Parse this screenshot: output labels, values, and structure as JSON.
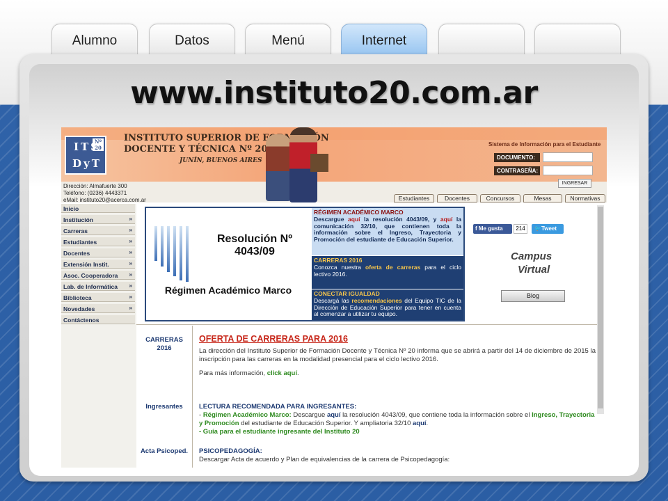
{
  "tabs": [
    {
      "label": "Alumno"
    },
    {
      "label": "Datos"
    },
    {
      "label": "Menú"
    },
    {
      "label": "Internet"
    },
    {
      "label": ""
    },
    {
      "label": ""
    }
  ],
  "slide_title": "www.instituto20.com.ar",
  "site": {
    "logo_top": "ITS",
    "logo_bottom": "DyT",
    "logo_num": "Nº 20",
    "institute_line1": "INSTITUTO SUPERIOR DE FORMACIÓN",
    "institute_line2": "DOCENTE Y TÉCNICA Nº 20",
    "institute_city": "JUNÍN, BUENOS AIRES",
    "address": "Dirección: Almafuerte 300",
    "phone": "Teléfono: (0236) 4443371",
    "email": "eMail: instituto20@acerca.com.ar",
    "sysinfo": "Sistema de Información para el Estudiante",
    "doc_label": "DOCUMENTO:",
    "pass_label": "CONTRASEÑA:",
    "login_button": "INGRESAR",
    "top_tabs": [
      "Estudiantes",
      "Docentes",
      "Concursos",
      "Mesas",
      "Normativas"
    ],
    "sidebar": [
      {
        "label": "Inicio",
        "chev": ""
      },
      {
        "label": "Institución",
        "chev": "»"
      },
      {
        "label": "Carreras",
        "chev": "»"
      },
      {
        "label": "Estudiantes",
        "chev": "»"
      },
      {
        "label": "Docentes",
        "chev": "»"
      },
      {
        "label": "Extensión Instit.",
        "chev": "»"
      },
      {
        "label": "Asoc. Cooperadora",
        "chev": "»"
      },
      {
        "label": "Lab. de Informática",
        "chev": "»"
      },
      {
        "label": "Biblioteca",
        "chev": "»"
      },
      {
        "label": "Novedades",
        "chev": "»"
      },
      {
        "label": "Contáctenos",
        "chev": ""
      }
    ],
    "banner": {
      "res_title": "Resolución Nº 4043/09",
      "res_foot": "Régimen Académico Marco",
      "b1_head": "RÉGIMEN ACADÉMICO MARCO",
      "b1_text1": "Descargue ",
      "b1_link1": "aquí",
      "b1_text2": " la resolución 4043/09, y ",
      "b1_link2": "aquí",
      "b1_text3": " la comunicación 32/10, que contienen toda la información sobre el Ingreso, Trayectoria y Promoción del estudiante de Educación Superior.",
      "b2_head": "CARRERAS 2016",
      "b2_text1": "Conozca nuestra ",
      "b2_link": "oferta de carreras",
      "b2_text2": " para el ciclo lectivo 2016.",
      "b3_head": "CONECTAR IGUALDAD",
      "b3_text1": "Descargá las ",
      "b3_link": "recomendaciones",
      "b3_text2": " del Equipo TIC de la Dirección de Educación Superior para tener en cuenta al comenzar a utilizar tu equipo."
    },
    "social": {
      "fb": "Me gusta",
      "fb_count": "214",
      "tw": "Tweet"
    },
    "campus": {
      "line1": "Campus",
      "line2": "Virtual"
    },
    "blog": "Blog",
    "rows": [
      {
        "label": "CARRERAS 2016",
        "title": "OFERTA DE CARRERAS PARA 2016",
        "text": "La dirección del Instituto Superior de Formación Docente y Técnica Nº 20 informa que se abrirá a partir del 14 de diciembre de 2015 la inscripción para las carreras en la modalidad presencial para el ciclo lectivo 2016.",
        "more": "Para más información, ",
        "more_link": "click aquí",
        "more_end": "."
      },
      {
        "label": "Ingresantes",
        "title": "LECTURA RECOMENDADA PARA INGRESANTES:",
        "l1a": "- ",
        "l1b": "Régimen Académico Marco:",
        "l1c": " Descargue ",
        "l1d": "aquí",
        "l1e": " la resolución 4043/09, que contiene toda la información sobre el ",
        "l1f": "Ingreso, Trayectoria y Promoción",
        "l1g": " del estudiante de Educación Superior. Y ampliatoria 32/10 ",
        "l1h": "aquí",
        "l1i": ".",
        "l2": "- Guía para el estudiante ingresante del Instituto 20"
      },
      {
        "label": "Acta Psicoped.",
        "title": "PSICOPEDAGOGÍA:",
        "text": "Descargar Acta de acuerdo y Plan de equivalencias de la carrera de Psicopedagogía:"
      }
    ]
  }
}
